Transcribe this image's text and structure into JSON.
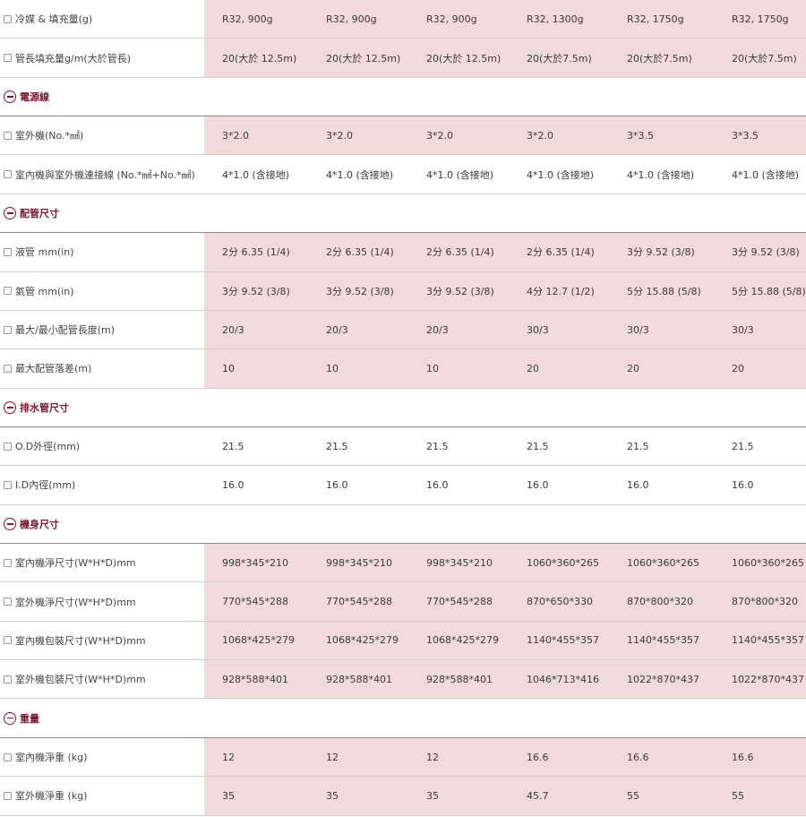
{
  "colors": {
    "shaded_bg": "#f0dadb",
    "section_accent": "#7b1830",
    "divider": "#cfcfcf"
  },
  "rows": [
    {
      "type": "data",
      "label": "冷媒 & 填充量(g)",
      "shaded": true,
      "values": [
        "R32, 900g",
        "R32, 900g",
        "R32, 900g",
        "R32, 1300g",
        "R32, 1750g",
        "R32, 1750g"
      ]
    },
    {
      "type": "data",
      "label": "管長填充量g/m(大於管長)",
      "shaded": true,
      "values": [
        "20(大於 12.5m)",
        "20(大於 12.5m)",
        "20(大於 12.5m)",
        "20(大於7.5m)",
        "20(大於7.5m)",
        "20(大於7.5m)"
      ]
    },
    {
      "type": "section",
      "label": "電源線",
      "icon": "minus-circle-icon"
    },
    {
      "type": "data",
      "label": "室外機(No.*㎟)",
      "shaded": true,
      "values": [
        "3*2.0",
        "3*2.0",
        "3*2.0",
        "3*2.0",
        "3*3.5",
        "3*3.5"
      ]
    },
    {
      "type": "data",
      "label": "室內機與室外機連接線 (No.*㎟+No.*㎟)",
      "shaded": false,
      "values": [
        "4*1.0 (含接地)",
        "4*1.0 (含接地)",
        "4*1.0 (含接地)",
        "4*1.0 (含接地)",
        "4*1.0 (含接地)",
        "4*1.0 (含接地)"
      ]
    },
    {
      "type": "section",
      "label": "配管尺寸",
      "icon": "minus-circle-icon"
    },
    {
      "type": "data",
      "label": "液管 mm(in)",
      "shaded": true,
      "values": [
        "2分 6.35 (1/4)",
        "2分 6.35 (1/4)",
        "2分 6.35 (1/4)",
        "2分 6.35 (1/4)",
        "3分 9.52 (3/8)",
        "3分 9.52 (3/8)"
      ]
    },
    {
      "type": "data",
      "label": "氣管 mm(in)",
      "shaded": true,
      "values": [
        "3分 9.52 (3/8)",
        "3分 9.52 (3/8)",
        "3分 9.52 (3/8)",
        "4分 12.7 (1/2)",
        "5分 15.88 (5/8)",
        "5分 15.88 (5/8)"
      ]
    },
    {
      "type": "data",
      "label": "最大/最小配管長度(m)",
      "shaded": true,
      "values": [
        "20/3",
        "20/3",
        "20/3",
        "30/3",
        "30/3",
        "30/3"
      ]
    },
    {
      "type": "data",
      "label": "最大配管落差(m)",
      "shaded": true,
      "values": [
        "10",
        "10",
        "10",
        "20",
        "20",
        "20"
      ]
    },
    {
      "type": "section",
      "label": "排水管尺寸",
      "icon": "minus-circle-icon"
    },
    {
      "type": "data",
      "label": "O.D外徑(mm)",
      "shaded": false,
      "values": [
        "21.5",
        "21.5",
        "21.5",
        "21.5",
        "21.5",
        "21.5"
      ]
    },
    {
      "type": "data",
      "label": "I.D內徑(mm)",
      "shaded": false,
      "values": [
        "16.0",
        "16.0",
        "16.0",
        "16.0",
        "16.0",
        "16.0"
      ]
    },
    {
      "type": "section",
      "label": "機身尺寸",
      "icon": "minus-circle-icon"
    },
    {
      "type": "data",
      "label": "室內機淨尺寸(W*H*D)mm",
      "shaded": true,
      "values": [
        "998*345*210",
        "998*345*210",
        "998*345*210",
        "1060*360*265",
        "1060*360*265",
        "1060*360*265"
      ]
    },
    {
      "type": "data",
      "label": "室外機淨尺寸(W*H*D)mm",
      "shaded": true,
      "values": [
        "770*545*288",
        "770*545*288",
        "770*545*288",
        "870*650*330",
        "870*800*320",
        "870*800*320"
      ]
    },
    {
      "type": "data",
      "label": "室內機包裝尺寸(W*H*D)mm",
      "shaded": true,
      "values": [
        "1068*425*279",
        "1068*425*279",
        "1068*425*279",
        "1140*455*357",
        "1140*455*357",
        "1140*455*357"
      ]
    },
    {
      "type": "data",
      "label": "室外機包裝尺寸(W*H*D)mm",
      "shaded": true,
      "values": [
        "928*588*401",
        "928*588*401",
        "928*588*401",
        "1046*713*416",
        "1022*870*437",
        "1022*870*437"
      ]
    },
    {
      "type": "section",
      "label": "重量",
      "icon": "minus-circle-icon"
    },
    {
      "type": "data",
      "label": "室內機淨重 (kg)",
      "shaded": true,
      "values": [
        "12",
        "12",
        "12",
        "16.6",
        "16.6",
        "16.6"
      ]
    },
    {
      "type": "data",
      "label": "室外機淨重 (kg)",
      "shaded": true,
      "values": [
        "35",
        "35",
        "35",
        "45.7",
        "55",
        "55"
      ]
    }
  ]
}
